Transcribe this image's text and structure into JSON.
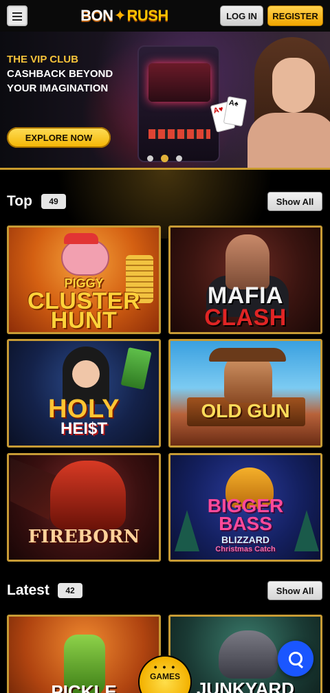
{
  "header": {
    "logo": {
      "part1": "BON",
      "star": "✦",
      "part2": "RUSH"
    },
    "login_label": "LOG IN",
    "register_label": "REGISTER"
  },
  "banner": {
    "line1": "THE VIP CLUB",
    "line2": "CASHBACK BEYOND",
    "line3": "YOUR IMAGINATION",
    "cta_label": "EXPLORE NOW",
    "slides": 3,
    "active_slide": 2,
    "cards": [
      "A♥",
      "A♠"
    ]
  },
  "sections": {
    "top": {
      "title": "Top",
      "count": "49",
      "show_all_label": "Show All",
      "games": [
        {
          "line1": "PIGGY",
          "line2": "CLUSTER",
          "line3": "HUNT"
        },
        {
          "line1": "MAFIA",
          "line2": "CLASH"
        },
        {
          "line1": "HOLY",
          "line2": "HEI$T"
        },
        {
          "line1": "OLD GUN"
        },
        {
          "line1": "FIREBORN"
        },
        {
          "line1": "BIGGER",
          "line2": "BASS",
          "line3": "BLIZZARD",
          "line4": "Christmas Catch"
        }
      ]
    },
    "latest": {
      "title": "Latest",
      "count": "42",
      "show_all_label": "Show All",
      "games": [
        {
          "line1": "PICKLE"
        },
        {
          "line1": "JUNKYARD"
        }
      ]
    }
  },
  "floating": {
    "games_label": "GAMES",
    "games_dots": "• • •"
  },
  "colors": {
    "accent_gold": "#f3b400",
    "tile_border": "#c79b35",
    "chat_blue": "#1a56ff"
  }
}
